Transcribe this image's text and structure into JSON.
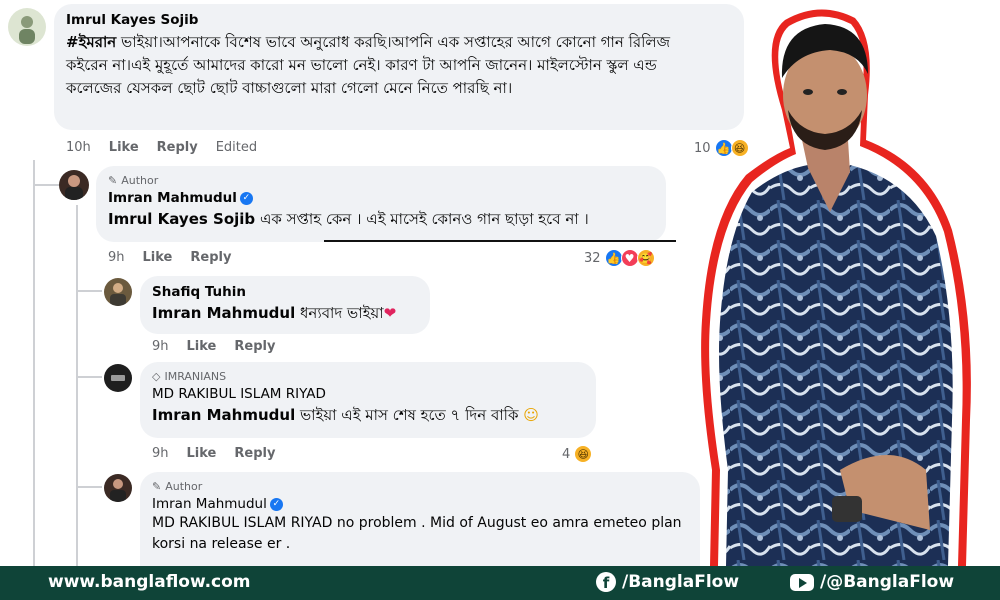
{
  "comments": {
    "c1": {
      "author": "Imrul Kayes Sojib",
      "hashtag": "#ইমরান",
      "text": " ভাইয়া।আপনাকে বিশেষ ভাবে অনুরোধ করছি।আপনি এক সপ্তাহের আগে কোনো গান রিলিজ কইরেন না।এই মুহূর্তে আমাদের কারো মন ভালো নেই। কারণ টা আপনি জানেন। মাইলস্টোন স্কুল এন্ড কলেজের যেসকল ছোট ছোট বাচ্চাগুলো মারা গেলো মেনে নিতে পারছি না।",
      "time": "10h",
      "like": "Like",
      "reply": "Reply",
      "edited": "Edited",
      "reaction_count": "10"
    },
    "c2": {
      "badge": "Author",
      "author": "Imran Mahmudul",
      "mention": "Imrul Kayes Sojib",
      "text": " এক সপ্তাহ কেন । এই মাসেই কোনও গান ছাড়া হবে না ।",
      "time": "9h",
      "like": "Like",
      "reply": "Reply",
      "reaction_count": "32"
    },
    "c3": {
      "author": "Shafiq Tuhin",
      "mention": "Imran Mahmudul",
      "text": " ধন্যবাদ ভাইয়া",
      "time": "9h",
      "like": "Like",
      "reply": "Reply"
    },
    "c4": {
      "badge": "IMRANIANS",
      "author": "MD RAKIBUL ISLAM RIYAD",
      "mention": "Imran Mahmudul",
      "text": " ভাইয়া এই মাস শেষ হতে ৭ দিন বাকি",
      "time": "9h",
      "like": "Like",
      "reply": "Reply",
      "reaction_count": "4"
    },
    "c5": {
      "badge": "Author",
      "author": "Imran Mahmudul",
      "mention": "MD RAKIBUL ISLAM RIYAD",
      "text": " no problem . Mid of August eo amra emeteo plan korsi na release er ."
    }
  },
  "footer": {
    "website": "www.banglaflow.com",
    "facebook": "/BanglaFlow",
    "youtube": "/@BanglaFlow"
  },
  "colors": {
    "bubble": "#f0f2f5",
    "footer": "#0f4438",
    "accent_red": "#e8251f",
    "like_blue": "#1877f2"
  }
}
